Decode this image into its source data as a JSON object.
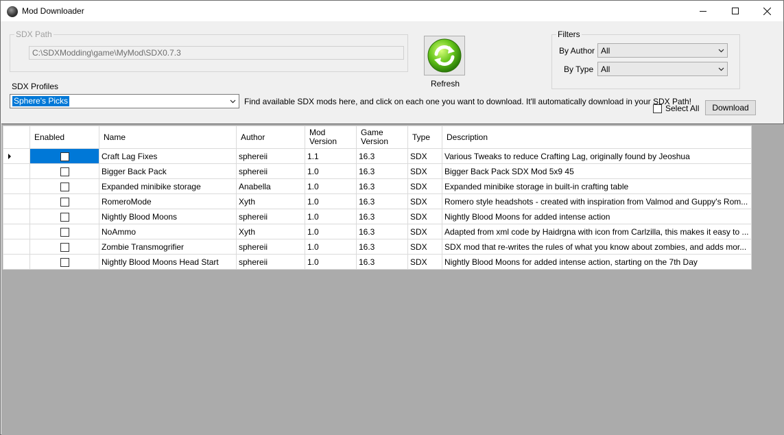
{
  "window": {
    "title": "Mod Downloader"
  },
  "sdx_path": {
    "legend": "SDX Path",
    "value": "C:\\SDXModding\\game\\MyMod\\SDX0.7.3"
  },
  "refresh": {
    "label": "Refresh"
  },
  "filters": {
    "legend": "Filters",
    "by_author_label": "By Author",
    "by_author_value": "All",
    "by_type_label": "By Type",
    "by_type_value": "All"
  },
  "profiles": {
    "label": "SDX Profiles",
    "selected": "Sphere's Picks"
  },
  "hint": "Find available SDX mods here, and click on each one you want to download. It'll automatically download in your SDX Path!",
  "select_all": {
    "label": "Select All",
    "checked": false
  },
  "download": {
    "label": "Download"
  },
  "grid": {
    "columns": {
      "enabled": "Enabled",
      "name": "Name",
      "author": "Author",
      "mod_version": "Mod Version",
      "game_version": "Game Version",
      "type": "Type",
      "description": "Description"
    },
    "rows": [
      {
        "name": "Craft Lag Fixes",
        "author": "sphereii",
        "mod_version": "1.1",
        "game_version": "16.3",
        "type": "SDX",
        "description": "Various Tweaks to reduce Crafting Lag, originally found by Jeoshua",
        "enabled": false
      },
      {
        "name": "Bigger Back Pack",
        "author": "sphereii",
        "mod_version": "1.0",
        "game_version": "16.3",
        "type": "SDX",
        "description": "Bigger Back Pack SDX Mod 5x9 45",
        "enabled": false
      },
      {
        "name": "Expanded minibike storage",
        "author": "Anabella",
        "mod_version": "1.0",
        "game_version": "16.3",
        "type": "SDX",
        "description": "Expanded minibike storage in built-in crafting table",
        "enabled": false
      },
      {
        "name": "RomeroMode",
        "author": "Xyth",
        "mod_version": "1.0",
        "game_version": "16.3",
        "type": "SDX",
        "description": "Romero style headshots - created with inspiration from Valmod and Guppy's Rom...",
        "enabled": false
      },
      {
        "name": "Nightly Blood Moons",
        "author": "sphereii",
        "mod_version": "1.0",
        "game_version": "16.3",
        "type": "SDX",
        "description": "Nightly Blood Moons for added intense action",
        "enabled": false
      },
      {
        "name": "NoAmmo",
        "author": "Xyth",
        "mod_version": "1.0",
        "game_version": "16.3",
        "type": "SDX",
        "description": "Adapted from xml code by Haidrgna with icon from Carlzilla, this makes it easy to ...",
        "enabled": false
      },
      {
        "name": "Zombie Transmogrifier",
        "author": "sphereii",
        "mod_version": "1.0",
        "game_version": "16.3",
        "type": "SDX",
        "description": "SDX mod that re-writes the rules of what you know about zombies, and adds mor...",
        "enabled": false
      },
      {
        "name": "Nightly Blood Moons Head Start",
        "author": "sphereii",
        "mod_version": "1.0",
        "game_version": "16.3",
        "type": "SDX",
        "description": "Nightly Blood Moons for added intense action, starting on the 7th Day",
        "enabled": false
      }
    ]
  },
  "colors": {
    "selection": "#0078d7",
    "grid_background": "#ababab"
  }
}
